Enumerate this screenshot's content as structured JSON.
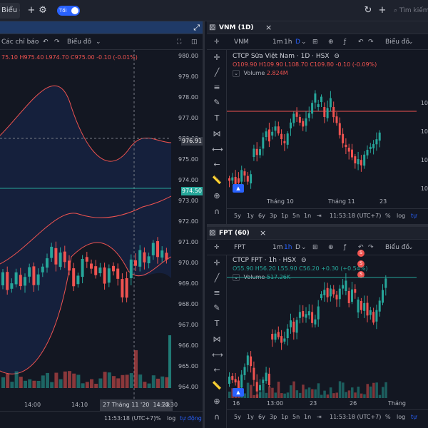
{
  "topbar": {
    "left_button": "Biểu đồ",
    "theme_label": "Tối",
    "search_placeholder": "Tìm kiếm"
  },
  "main_chart": {
    "toolbar": {
      "indicators": "Các chỉ báo",
      "chart_type": "Biểu đồ"
    },
    "legend_ohlc": "75.10 H975.40 L974.70 C975.00 -0.10 (-0.01%)",
    "price_labels": [
      "980.00",
      "979.00",
      "978.00",
      "977.00",
      "976.00",
      "975.00",
      "974.00",
      "973.00",
      "972.00",
      "971.00",
      "970.00",
      "969.00",
      "968.00",
      "967.00",
      "966.00",
      "965.00",
      "964.00"
    ],
    "crosshair_price": "976.91",
    "last_price": "974.50",
    "time_labels": [
      "14:00",
      "14:10",
      "14:30"
    ],
    "time_tag": "27 Tháng 11 '20",
    "time_tag2": "14:23",
    "bottom": {
      "clock": "11:53:18 (UTC+7)",
      "percent": "%",
      "log": "log",
      "auto": "tự động"
    }
  },
  "vnm_chart": {
    "tab_title": "VNM (1D)",
    "symbol": "VNM",
    "intervals": [
      "1m",
      "1h",
      "D"
    ],
    "chart_type": "Biểu đồ",
    "legend_title": "CTCP Sữa Việt Nam · 1D · HSX",
    "legend_ohlc": "O109.90 H109.90 L108.70 C109.80 -0.10 (-0.09%)",
    "volume_label": "Volume",
    "volume_value": "2.824M",
    "price_labels": [
      "10",
      "10",
      "10",
      "10"
    ],
    "time_labels": [
      "Tháng 10",
      "Tháng 11",
      "23"
    ],
    "bottom": {
      "ranges": [
        "5y",
        "1y",
        "6y",
        "3p",
        "1p",
        "5n",
        "1n"
      ],
      "clock": "11:53:18 (UTC+7)",
      "percent": "%",
      "log": "log",
      "auto": "tự"
    }
  },
  "fpt_chart": {
    "tab_title": "FPT (60)",
    "symbol": "FPT",
    "intervals": [
      "1m",
      "1h",
      "D"
    ],
    "chart_type": "Biểu đồ",
    "legend_title": "CTCP FPT · 1h · HSX",
    "legend_ohlc": "O55.90 H56.20 L55.90 C56.20 +0.30 (+0.54%)",
    "volume_label": "Volume",
    "volume_value": "517.26K",
    "event_labels": [
      "S",
      "S",
      "S"
    ],
    "time_labels": [
      "16",
      "13:00",
      "23",
      "26",
      "Tháng Mười"
    ],
    "bottom": {
      "ranges": [
        "5y",
        "1y",
        "6y",
        "3p",
        "1p",
        "5n",
        "1n"
      ],
      "clock": "11:53:18 (UTC+7)",
      "percent": "%",
      "log": "log",
      "auto": "tự"
    }
  },
  "colors": {
    "up": "#26a69a",
    "down": "#ef5350",
    "accent": "#2962ff",
    "bg": "#131722"
  }
}
